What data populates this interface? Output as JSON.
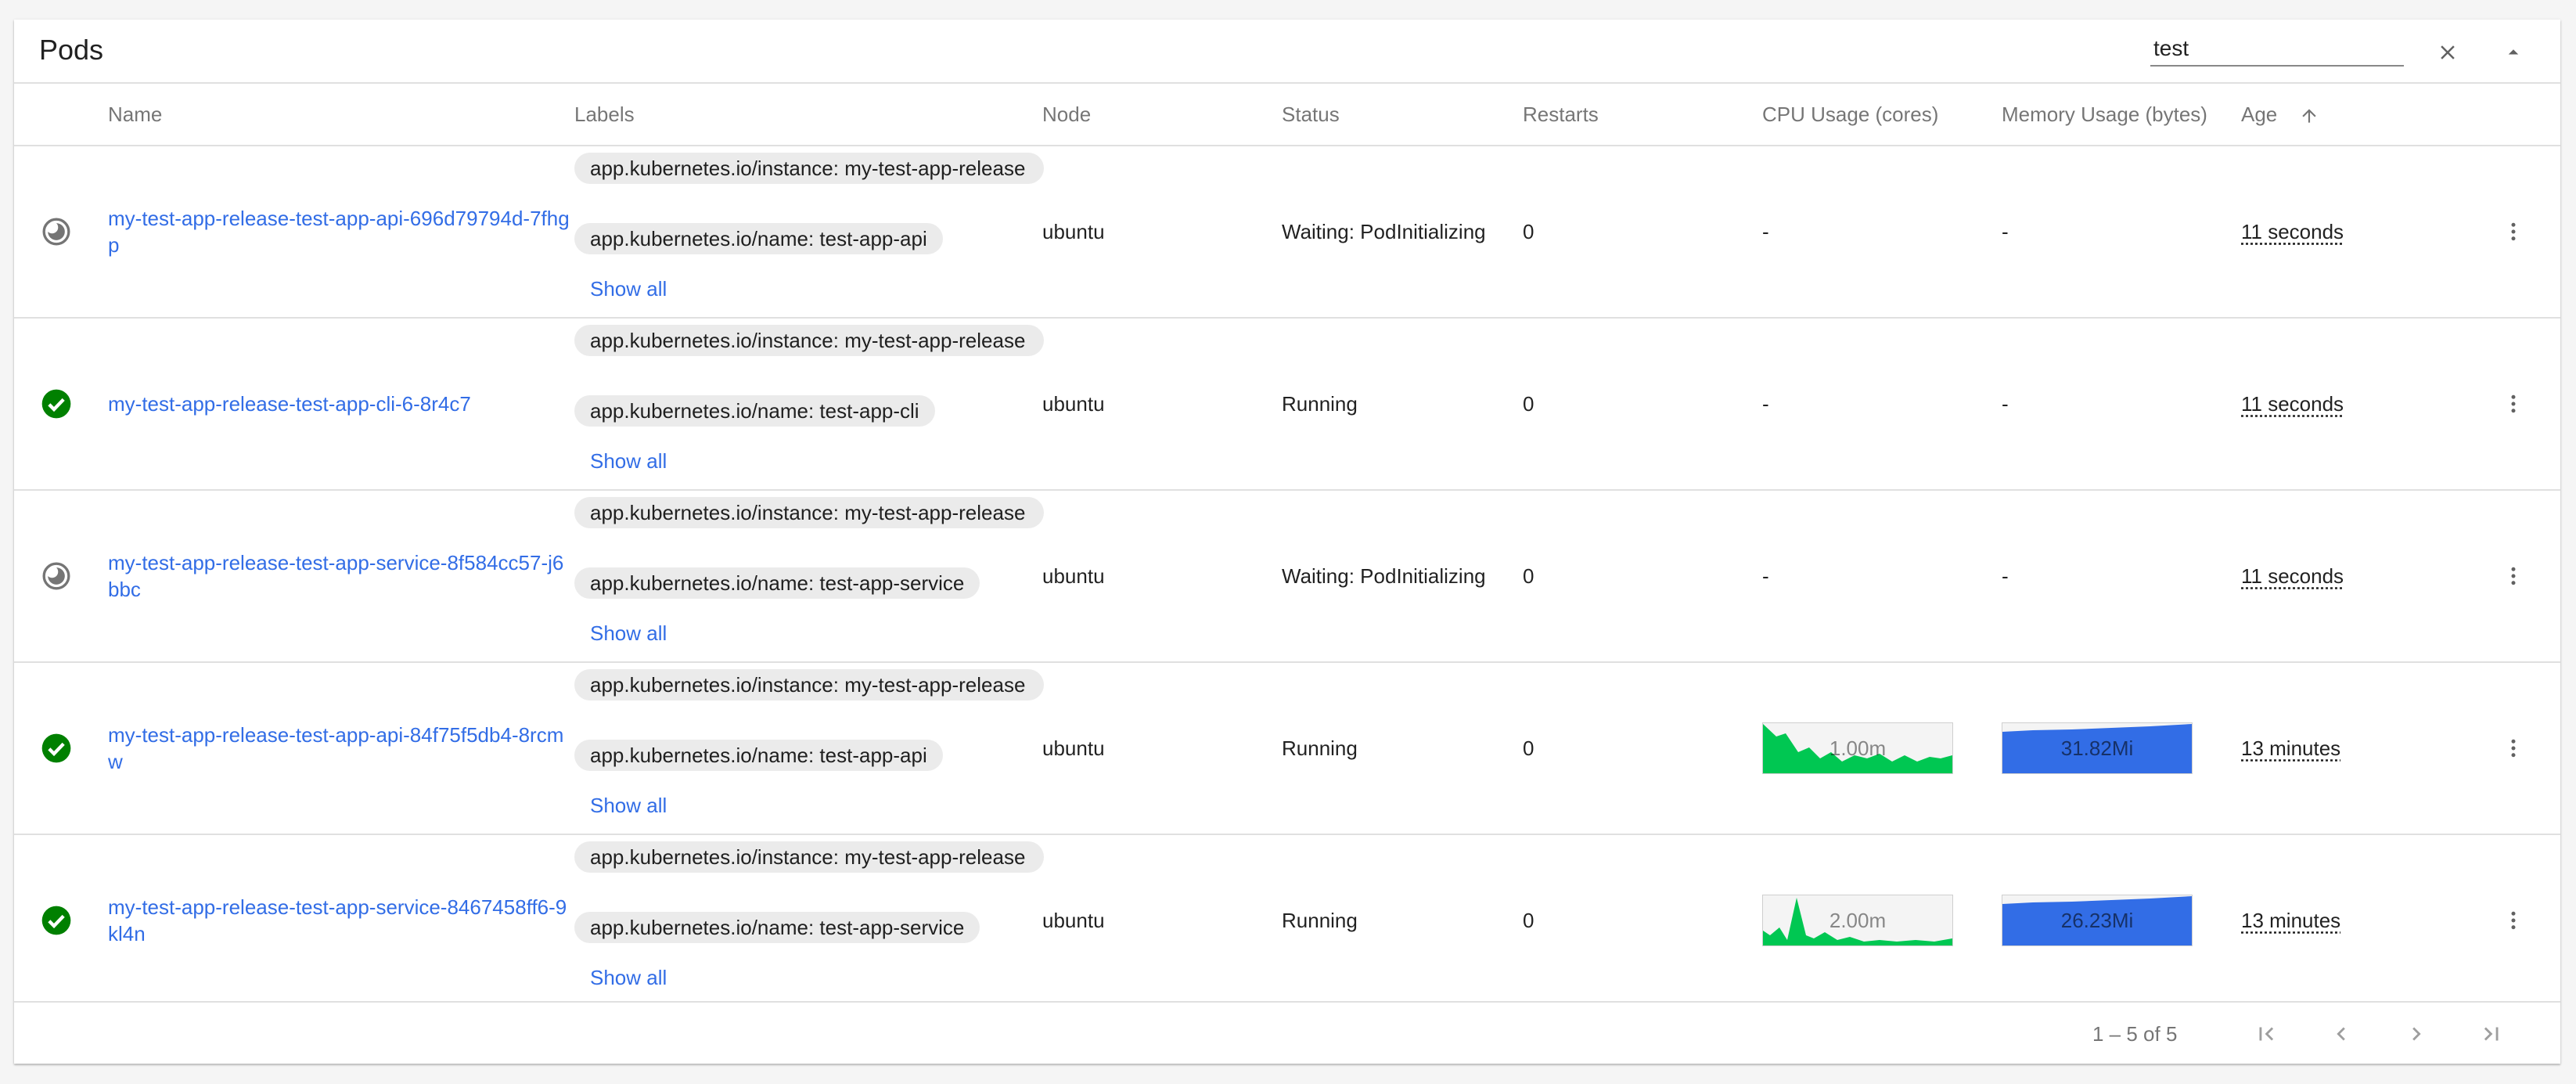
{
  "panel": {
    "title": "Pods"
  },
  "search": {
    "value": "test"
  },
  "columns": {
    "name": "Name",
    "labels": "Labels",
    "node": "Node",
    "status": "Status",
    "restarts": "Restarts",
    "cpu": "CPU Usage (cores)",
    "memory": "Memory Usage (bytes)",
    "age": "Age"
  },
  "rows": [
    {
      "status_icon": "pending-icon",
      "name": "my-test-app-release-test-app-api-696d79794d-7fhgp",
      "label_instance": "app.kubernetes.io/instance: my-test-app-release",
      "label_name": "app.kubernetes.io/name: test-app-api",
      "show_all": "Show all",
      "node": "ubuntu",
      "status": "Waiting: PodInitializing",
      "restarts": "0",
      "cpu": "-",
      "memory": "-",
      "age": "11 seconds"
    },
    {
      "status_icon": "check-circle-icon",
      "name": "my-test-app-release-test-app-cli-6-8r4c7",
      "label_instance": "app.kubernetes.io/instance: my-test-app-release",
      "label_name": "app.kubernetes.io/name: test-app-cli",
      "show_all": "Show all",
      "node": "ubuntu",
      "status": "Running",
      "restarts": "0",
      "cpu": "-",
      "memory": "-",
      "age": "11 seconds"
    },
    {
      "status_icon": "pending-icon",
      "name": "my-test-app-release-test-app-service-8f584cc57-j6bbc",
      "label_instance": "app.kubernetes.io/instance: my-test-app-release",
      "label_name": "app.kubernetes.io/name: test-app-service",
      "show_all": "Show all",
      "node": "ubuntu",
      "status": "Waiting: PodInitializing",
      "restarts": "0",
      "cpu": "-",
      "memory": "-",
      "age": "11 seconds"
    },
    {
      "status_icon": "check-circle-icon",
      "name": "my-test-app-release-test-app-api-84f75f5db4-8rcmw",
      "label_instance": "app.kubernetes.io/instance: my-test-app-release",
      "label_name": "app.kubernetes.io/name: test-app-api",
      "show_all": "Show all",
      "node": "ubuntu",
      "status": "Running",
      "restarts": "0",
      "cpu": "1.00m",
      "memory": "31.82Mi",
      "age": "13 minutes"
    },
    {
      "status_icon": "check-circle-icon",
      "name": "my-test-app-release-test-app-service-8467458ff6-9kl4n",
      "label_instance": "app.kubernetes.io/instance: my-test-app-release",
      "label_name": "app.kubernetes.io/name: test-app-service",
      "show_all": "Show all",
      "node": "ubuntu",
      "status": "Running",
      "restarts": "0",
      "cpu": "2.00m",
      "memory": "26.23Mi",
      "age": "13 minutes"
    }
  ],
  "pagination": {
    "range": "1 – 5 of 5"
  },
  "colors": {
    "link": "#326de6",
    "running": "#008000",
    "pending": "#757575",
    "cpu_spark": "#00c752",
    "mem_spark": "#326de6"
  }
}
